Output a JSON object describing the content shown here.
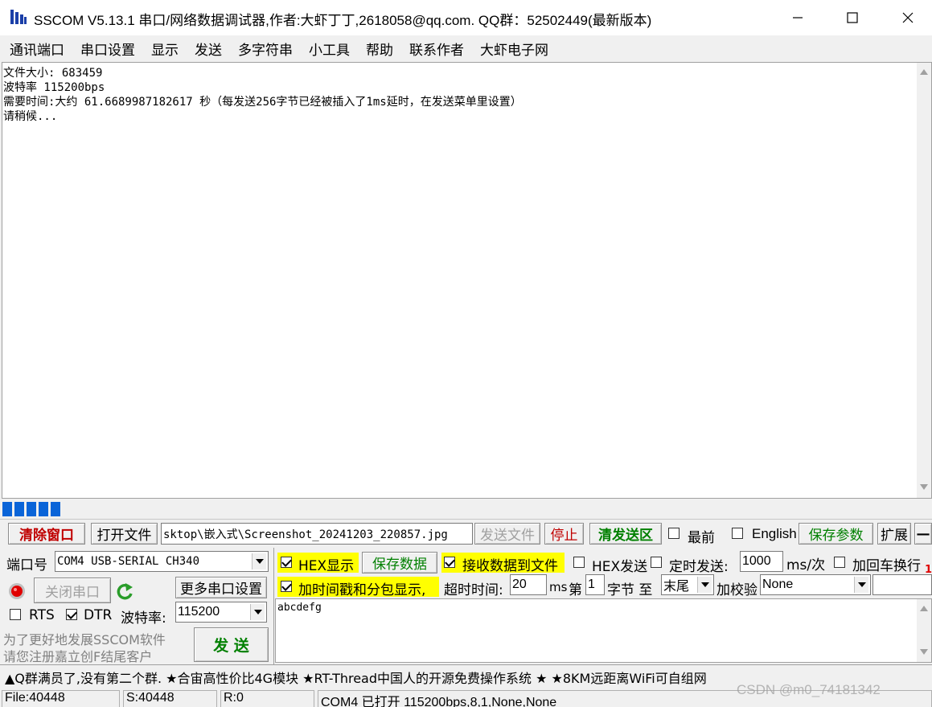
{
  "window": {
    "title": "SSCOM V5.13.1 串口/网络数据调试器,作者:大虾丁丁,2618058@qq.com. QQ群：52502449(最新版本)"
  },
  "menu": [
    "通讯端口",
    "串口设置",
    "显示",
    "发送",
    "多字符串",
    "小工具",
    "帮助",
    "联系作者",
    "大虾电子网"
  ],
  "receive": {
    "lines": [
      "文件大小: 683459",
      "波特率 115200bps",
      "需要时间:大约 61.6689987182617 秒（每发送256字节已经被插入了1ms延时，在发送菜单里设置）",
      "请稍候..."
    ],
    "progress_blocks": 5
  },
  "toolbar": {
    "clear_window": "清除窗口",
    "open_file": "打开文件",
    "file_path": "sktop\\嵌入式\\Screenshot_20241203_220857.jpg",
    "send_file": "发送文件",
    "stop": "停止",
    "clear_send": "清发送区",
    "topmost_label": "最前",
    "english_label": "English",
    "save_params": "保存参数",
    "expand": "扩展",
    "collapse": "—"
  },
  "port": {
    "port_label": "端口号",
    "port_value": "COM4 USB-SERIAL CH340",
    "close_port": "关闭串口",
    "more_settings": "更多串口设置",
    "rts_label": "RTS",
    "dtr_label": "DTR",
    "baud_label": "波特率:",
    "baud_value": "115200",
    "promo_line1": "为了更好地发展SSCOM软件",
    "promo_line2": "请您注册嘉立创F结尾客户",
    "send_button": "发 送"
  },
  "options": {
    "hex_display": "HEX显示",
    "save_data": "保存数据",
    "recv_to_file": "接收数据到文件",
    "hex_send": "HEX发送",
    "timed_send": "定时发送:",
    "interval_value": "1000",
    "interval_unit": "ms/次",
    "add_crlf": "加回车换行",
    "timestamp": "加时间戳和分包显示,",
    "timeout_label": "超时时间:",
    "timeout_value": "20",
    "timeout_unit": "ms",
    "byte_prefix": "第",
    "byte_value": "1",
    "byte_label": "字节 至",
    "end_value": "末尾",
    "checksum_label": "加校验",
    "checksum_value": "None",
    "corner_mark": "1"
  },
  "send_area": {
    "text": "abcdefg"
  },
  "ticker": "▲Q群满员了,没有第二个群. ★合宙高性价比4G模块 ★RT-Thread中国人的开源免费操作系统 ★ ★8KM远距离WiFi可自组网",
  "status": {
    "file": "File:40448",
    "sent": "S:40448",
    "received": "R:0",
    "port_status": "COM4 已打开  115200bps,8,1,None,None"
  },
  "watermark": "CSDN @m0_74181342",
  "colors": {
    "accent_blue": "#0a64d8",
    "highlight_yellow": "#ffff00",
    "red_text": "#c00000",
    "green_text": "#008000"
  }
}
